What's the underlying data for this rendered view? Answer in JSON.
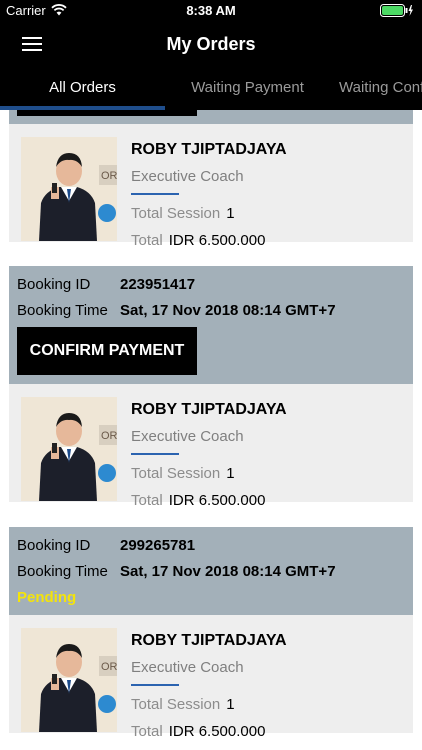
{
  "status_bar": {
    "carrier": "Carrier",
    "time": "8:38 AM"
  },
  "header": {
    "title": "My Orders"
  },
  "tabs": [
    {
      "label": "All Orders"
    },
    {
      "label": "Waiting Payment"
    },
    {
      "label": "Waiting Confirmation"
    }
  ],
  "orders": [
    {
      "coach_name": "ROBY TJIPTADJAYA",
      "coach_role": "Executive Coach",
      "session_label": "Total Session",
      "session_value": "1",
      "total_label": "Total",
      "total_value": "IDR 6.500.000"
    },
    {
      "booking_id_label": "Booking ID",
      "booking_id": "223951417",
      "booking_time_label": "Booking Time",
      "booking_time": "Sat, 17 Nov 2018 08:14 GMT+7",
      "action_label": "CONFIRM PAYMENT",
      "coach_name": "ROBY TJIPTADJAYA",
      "coach_role": "Executive Coach",
      "session_label": "Total Session",
      "session_value": "1",
      "total_label": "Total",
      "total_value": "IDR 6.500.000"
    },
    {
      "booking_id_label": "Booking ID",
      "booking_id": "299265781",
      "booking_time_label": "Booking Time",
      "booking_time": "Sat, 17 Nov 2018 08:14 GMT+7",
      "status": "Pending",
      "coach_name": "ROBY TJIPTADJAYA",
      "coach_role": "Executive Coach",
      "session_label": "Total Session",
      "session_value": "1",
      "total_label": "Total",
      "total_value": "IDR 6.500.000"
    }
  ],
  "colors": {
    "accent": "#1f4e8c",
    "pending": "#f4e40a",
    "header_bg": "#a3b0b9"
  }
}
